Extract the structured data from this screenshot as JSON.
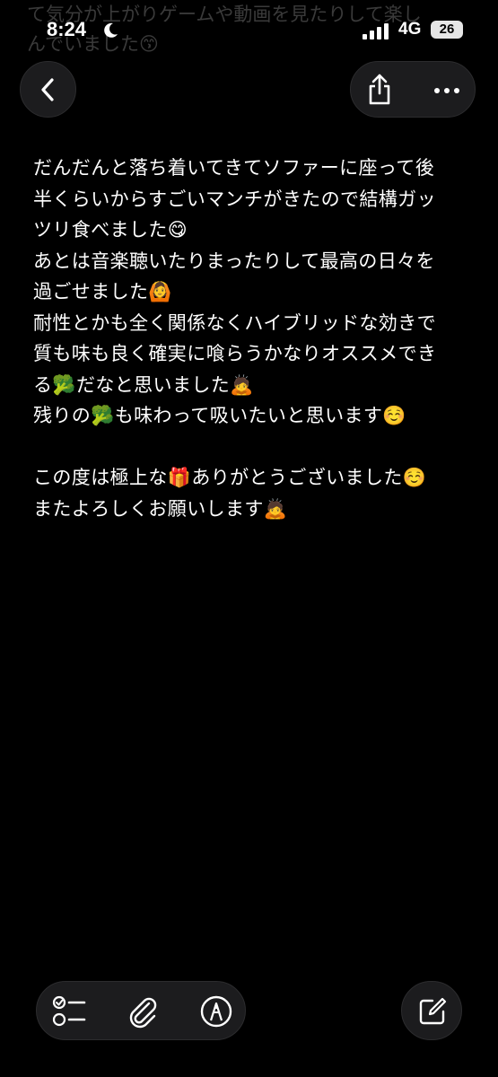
{
  "previous_text_lines": [
    "て気分が上がりゲームや動画を見たりして楽し",
    "んでいました😙"
  ],
  "status_bar": {
    "time": "8:24",
    "network": "4G",
    "battery_level": "26"
  },
  "note": {
    "lines": [
      "だんだんと落ち着いてきてソファーに座って後",
      "半くらいからすごいマンチがきたので結構ガッ",
      "ツリ食べました😋",
      "あとは音楽聴いたりまったりして最高の日々を",
      "過ごせました🙆",
      "耐性とかも全く関係なくハイブリッドな効きで",
      "質も味も良く確実に喰らうかなりオススメでき",
      "る🥦だなと思いました🙇",
      "残りの🥦も味わって吸いたいと思います☺️",
      "",
      "この度は極上な🎁ありがとうございました☺️",
      "またよろしくお願いします🙇"
    ]
  },
  "icons": {
    "back": "chevron-left-icon",
    "share": "share-icon",
    "more": "ellipsis-icon",
    "checklist": "checklist-icon",
    "attach": "paperclip-icon",
    "markup": "pen-circle-icon",
    "compose": "compose-icon",
    "moon": "moon-icon",
    "signal": "signal-bars-icon"
  },
  "colors": {
    "background": "#000000",
    "button_bg": "#1c1c1e",
    "text": "#ffffff"
  }
}
